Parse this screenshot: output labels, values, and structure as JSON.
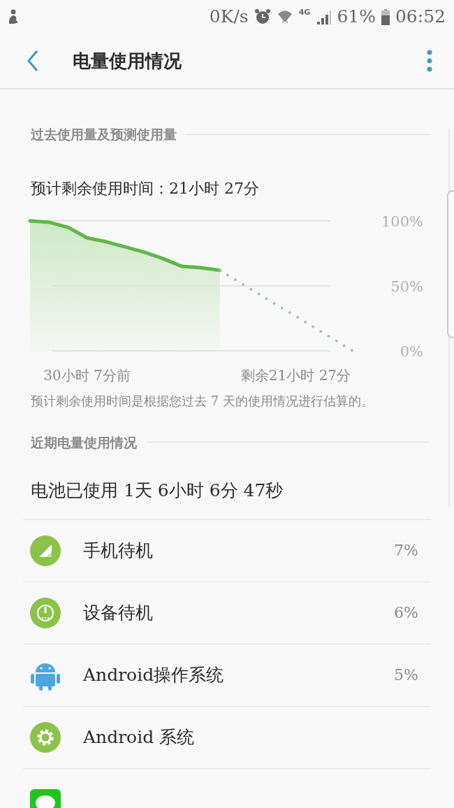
{
  "status_bar": {
    "speed": "0K/s",
    "network": "4G",
    "battery_text": "61%",
    "time": "06:52"
  },
  "app_bar": {
    "title": "电量使用情况"
  },
  "forecast_section": {
    "header": "过去使用量及预测使用量",
    "estimate": "预计剩余使用时间：21小时 27分",
    "chart_data": {
      "type": "area",
      "categories": [
        null,
        null,
        null,
        "30小时 7分前",
        null,
        null,
        null,
        null,
        null,
        null,
        null,
        null,
        null,
        null,
        "剩余21小时 27分",
        null,
        null,
        null
      ],
      "ylim": [
        0,
        100
      ],
      "series": [
        {
          "color": "#5cb946",
          "values": [
            100,
            99,
            95,
            87,
            84,
            80,
            76,
            71,
            65,
            64,
            62,
            null,
            null,
            null,
            null,
            null,
            null,
            null
          ]
        },
        {
          "type": "line",
          "line_style": "dotted",
          "color": "#a9bcc4",
          "values": [
            null,
            null,
            null,
            null,
            null,
            null,
            null,
            null,
            null,
            null,
            62,
            53.1,
            44.3,
            35.4,
            26.6,
            17.7,
            8.9,
            0
          ]
        }
      ],
      "yticks": [
        {
          "value": 0,
          "label": "0%"
        },
        {
          "value": 50,
          "label": "50%"
        },
        {
          "value": 100,
          "label": "100%"
        }
      ]
    },
    "note": "预计剩余使用时间是根据您过去 7 天的使用情况进行估算的。"
  },
  "recent_section": {
    "header": "近期电量使用情况",
    "used": "电池已使用 1天 6小时 6分 47秒",
    "items": [
      {
        "kind": "signal",
        "name": "手机待机",
        "percent": "7%"
      },
      {
        "kind": "power",
        "name": "设备待机",
        "percent": "6%"
      },
      {
        "kind": "android",
        "name": "Android操作系统",
        "percent": "5%"
      },
      {
        "kind": "gear",
        "name": "Android 系统"
      },
      {
        "kind": "chat"
      }
    ]
  }
}
